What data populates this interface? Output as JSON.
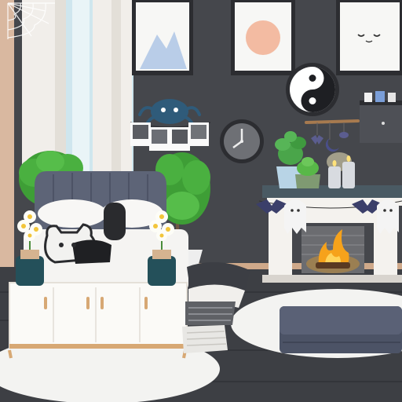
{
  "scene": {
    "colors": {
      "wall": "#45474c",
      "wall_shadow": "#3b3d42",
      "floor": "#3d3f44",
      "floor_line": "#33353a",
      "curtain": "#f1eeea",
      "window_glass": "#cfe6ee",
      "rug": "#f3f3f1",
      "headboard": "#5d6477",
      "bed_sheet": "#f5f4f2",
      "cabinet": "#fbfaf7",
      "cabinet_trim": "#d7a874",
      "vase": "#24505a",
      "fireplace": "#f4f2ee",
      "fire": "#f6a21b",
      "ottoman": "#5a6176",
      "plant": "#3e9e36",
      "frame": "#2c2d31"
    },
    "icons": {
      "cobweb": "cobweb-icon",
      "mountain_art": "mountain-art-icon",
      "sun_art": "sun-art-icon",
      "face_art": "sleepy-face-art-icon",
      "yin_yang": "yin-yang-icon",
      "clock": "wall-clock-icon",
      "spider": "spider-decoration-icon",
      "bat": "bat-icon",
      "ghost": "ghost-icon",
      "moon": "moon-icon",
      "candle": "candle-icon",
      "flower": "daisy-flower-icon",
      "fire": "fire-icon"
    }
  }
}
